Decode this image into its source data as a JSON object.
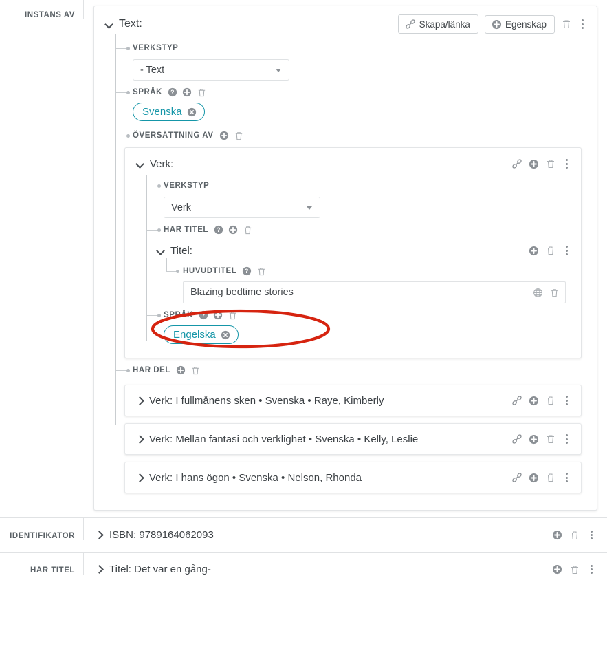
{
  "colors": {
    "chip_teal": "#1596a8",
    "annotation_red": "#d62410",
    "label_gray": "#5a6166",
    "text_dark": "#3d4246",
    "border": "#e3e5e7"
  },
  "rows": {
    "instans_av": {
      "label": "INSTANS AV",
      "card": {
        "title": "Text:",
        "toolbar": {
          "create_link_label": "Skapa/länka",
          "create_link_icon": "link-icon",
          "property_label": "Egenskap",
          "property_icon": "plus-circle-icon",
          "delete_icon": "trash-icon",
          "more_icon": "kebab-menu-icon"
        },
        "fields": [
          {
            "label": "VERKSTYP",
            "icons": [],
            "control": {
              "kind": "select",
              "value": "- Text"
            }
          },
          {
            "label": "SPRÅK",
            "icons": [
              "help-icon",
              "plus-circle-icon",
              "trash-icon"
            ],
            "control": {
              "kind": "chip",
              "value": "Svenska",
              "remove_icon": "remove-circle-icon"
            }
          },
          {
            "label": "ÖVERSÄTTNING AV",
            "icons": [
              "plus-circle-icon",
              "trash-icon"
            ],
            "control": {
              "kind": "card"
            }
          }
        ],
        "inner_card": {
          "title": "Verk:",
          "actions": [
            "link-icon",
            "plus-circle-icon",
            "trash-icon",
            "kebab-menu-icon"
          ],
          "fields": [
            {
              "label": "VERKSTYP",
              "icons": [],
              "control": {
                "kind": "select",
                "value": "Verk"
              }
            },
            {
              "label": "HAR TITEL",
              "icons": [
                "help-icon",
                "plus-circle-icon",
                "trash-icon"
              ],
              "control": {
                "kind": "group"
              }
            }
          ],
          "title_group": {
            "title": "Titel:",
            "actions": [
              "plus-circle-icon",
              "trash-icon",
              "kebab-menu-icon"
            ],
            "field": {
              "label": "HUVUDTITEL",
              "icons": [
                "help-icon",
                "trash-icon"
              ],
              "control": {
                "kind": "text",
                "value": "Blazing bedtime stories",
                "right_icons": [
                  "globe-icon",
                  "trash-icon"
                ],
                "highlighted": true
              }
            }
          },
          "language_field": {
            "label": "SPRÅK",
            "icons": [
              "help-icon",
              "plus-circle-icon",
              "trash-icon"
            ],
            "control": {
              "kind": "chip",
              "value": "Engelska",
              "remove_icon": "remove-circle-icon"
            }
          }
        },
        "har_del": {
          "label": "HAR DEL",
          "icons": [
            "plus-circle-icon",
            "trash-icon"
          ],
          "items": [
            {
              "chevron": "chevron-right-icon",
              "text": "Verk: I fullmånens sken • Svenska • Raye, Kimberly",
              "actions": [
                "link-icon",
                "plus-circle-icon",
                "trash-icon",
                "kebab-menu-icon"
              ]
            },
            {
              "chevron": "chevron-right-icon",
              "text": "Verk: Mellan fantasi och verklighet • Svenska • Kelly, Leslie",
              "actions": [
                "link-icon",
                "plus-circle-icon",
                "trash-icon",
                "kebab-menu-icon"
              ]
            },
            {
              "chevron": "chevron-right-icon",
              "text": "Verk: I hans ögon • Svenska • Nelson, Rhonda",
              "actions": [
                "link-icon",
                "plus-circle-icon",
                "trash-icon",
                "kebab-menu-icon"
              ]
            }
          ]
        }
      }
    },
    "identifikator": {
      "label": "IDENTIFIKATOR",
      "chevron": "chevron-right-icon",
      "text": "ISBN: 9789164062093",
      "actions": [
        "plus-circle-icon",
        "trash-icon",
        "kebab-menu-icon"
      ]
    },
    "har_titel": {
      "label": "HAR TITEL",
      "chevron": "chevron-right-icon",
      "text": "Titel: Det var en gång-",
      "actions": [
        "plus-circle-icon",
        "trash-icon",
        "kebab-menu-icon"
      ]
    }
  },
  "annotation": {
    "shape": "ellipse",
    "target": "huvudtitel-input"
  }
}
